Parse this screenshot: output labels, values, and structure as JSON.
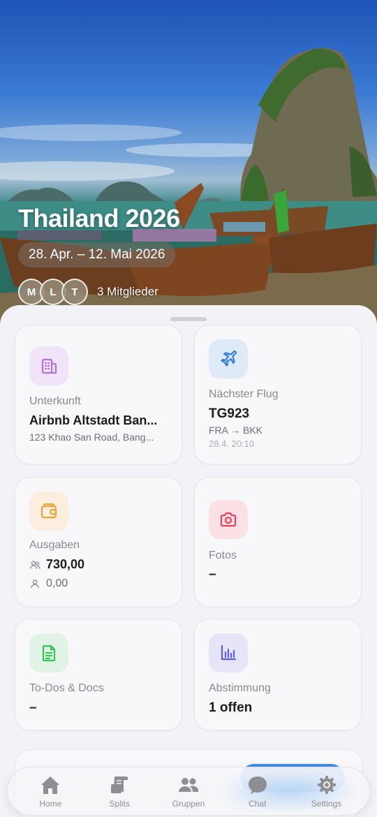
{
  "trip": {
    "title": "Thailand 2026",
    "dates": "28. Apr. – 12. Mai 2026",
    "member_initials": [
      "M",
      "L",
      "T"
    ],
    "member_count": "3 Mitglieder"
  },
  "cards": {
    "accommodation": {
      "label": "Unterkunft",
      "name": "Airbnb Altstadt Ban...",
      "address": "123 Khao San Road, Bang..."
    },
    "flight": {
      "label": "Nächster Flug",
      "number": "TG923",
      "route": "FRA → BKK",
      "time": "28.4. 20:10"
    },
    "expenses": {
      "label": "Ausgaben",
      "group_amount": "730,00",
      "own_amount": "0,00"
    },
    "photos": {
      "label": "Fotos",
      "value": "–"
    },
    "todos": {
      "label": "To-Dos & Docs",
      "value": "–"
    },
    "voting": {
      "label": "Abstimmung",
      "value": "1 offen"
    }
  },
  "tabs": [
    {
      "label": "Home",
      "icon": "house-icon"
    },
    {
      "label": "Splits",
      "icon": "receipt-icon"
    },
    {
      "label": "Gruppen",
      "icon": "people-icon"
    },
    {
      "label": "Chat",
      "icon": "chat-bubble-icon"
    },
    {
      "label": "Settings",
      "icon": "gear-icon"
    }
  ],
  "colors": {
    "accommodation_icon": "#b46ee0",
    "flight_icon": "#2f7de1",
    "expenses_icon": "#f0a23a",
    "photos_icon": "#e6405d",
    "todos_icon": "#34c759",
    "voting_icon": "#5e5ce6"
  }
}
